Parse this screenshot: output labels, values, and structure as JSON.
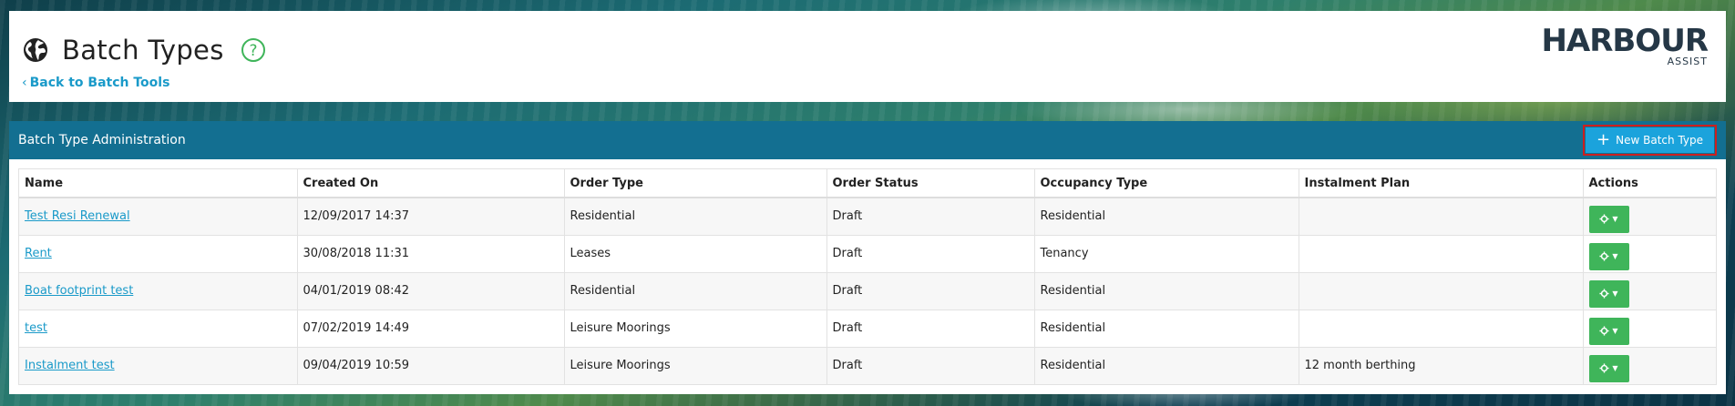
{
  "header": {
    "title": "Batch Types",
    "back_link": "Back to Batch Tools",
    "logo_main": "HARBOUR",
    "logo_sub": "ASSIST"
  },
  "panel": {
    "title": "Batch Type Administration",
    "new_button": "New Batch Type"
  },
  "table": {
    "columns": [
      "Name",
      "Created On",
      "Order Type",
      "Order Status",
      "Occupancy Type",
      "Instalment Plan",
      "Actions"
    ],
    "rows": [
      {
        "name": "Test Resi Renewal",
        "created_on": "12/09/2017 14:37",
        "order_type": "Residential",
        "order_status": "Draft",
        "occupancy_type": "Residential",
        "instalment_plan": ""
      },
      {
        "name": "Rent",
        "created_on": "30/08/2018 11:31",
        "order_type": "Leases",
        "order_status": "Draft",
        "occupancy_type": "Tenancy",
        "instalment_plan": ""
      },
      {
        "name": "Boat footprint test",
        "created_on": "04/01/2019 08:42",
        "order_type": "Residential",
        "order_status": "Draft",
        "occupancy_type": "Residential",
        "instalment_plan": ""
      },
      {
        "name": "test",
        "created_on": "07/02/2019 14:49",
        "order_type": "Leisure Moorings",
        "order_status": "Draft",
        "occupancy_type": "Residential",
        "instalment_plan": ""
      },
      {
        "name": "Instalment test",
        "created_on": "09/04/2019 10:59",
        "order_type": "Leisure Moorings",
        "order_status": "Draft",
        "occupancy_type": "Residential",
        "instalment_plan": "12 month berthing"
      }
    ]
  },
  "icons": {
    "title_icon": "globe-icon",
    "help_icon": "help-icon",
    "action_icon": "gear-icon"
  },
  "colors": {
    "panel_header": "#136f91",
    "primary_button": "#1ba3dc",
    "action_button": "#3fb55a",
    "link": "#1a9ac9",
    "highlight": "#cc1f1f"
  }
}
